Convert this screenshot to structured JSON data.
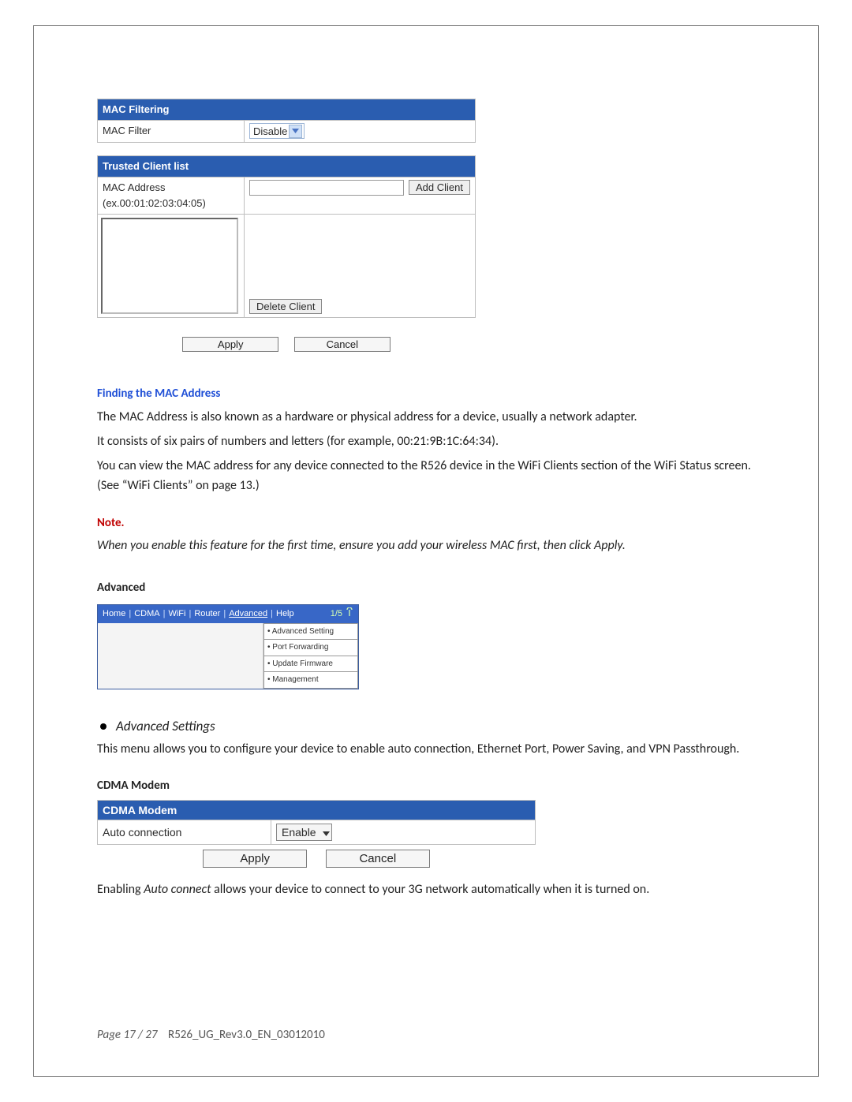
{
  "mac_filtering": {
    "header": "MAC Filtering",
    "row_label": "MAC Filter",
    "dropdown_value": "Disable"
  },
  "trusted": {
    "header": "Trusted Client list",
    "row_label": "MAC Address\n(ex.00:01:02:03:04:05)",
    "add_btn": "Add Client",
    "delete_btn": "Delete Client"
  },
  "macpanel_buttons": {
    "apply": "Apply",
    "cancel": "Cancel"
  },
  "finding_mac": {
    "heading": "Finding the MAC Address",
    "p1": "The MAC Address is also known as a hardware or physical address for a device, usually a network adapter.",
    "p2": "It consists of six pairs of numbers and letters (for example, 00:21:9B:1C:64:34).",
    "p3": "You can view the MAC address for any device connected to the R526 device in the WiFi Clients section of the WiFi Status screen. (See “WiFi Clients” on page 13.)"
  },
  "note": {
    "heading": "Note.",
    "text": "When you enable this feature for the first time, ensure you add your wireless MAC first, then click Apply."
  },
  "advanced": {
    "heading": "Advanced",
    "nav": {
      "items": [
        "Home",
        "CDMA",
        "WiFi",
        "Router",
        "Advanced",
        "Help"
      ],
      "signal": "1/5",
      "menu": [
        "Advanced Setting",
        "Port Forwarding",
        "Update Firmware",
        "Management"
      ]
    },
    "bullet": "Advanced Settings",
    "desc": "This menu allows you to configure your device to enable auto connection, Ethernet Port, Power Saving, and VPN Passthrough."
  },
  "cdma": {
    "sub": "CDMA Modem",
    "header": "CDMA Modem",
    "row_label": "Auto connection",
    "dropdown_value": "Enable",
    "apply": "Apply",
    "cancel": "Cancel",
    "after_pre": "Enabling ",
    "after_em": "Auto connect",
    "after_post": " allows your device to connect to your 3G network automatically when it is turned on."
  },
  "footer": {
    "page": "Page 17 / 27",
    "doc": "R526_UG_Rev3.0_EN_03012010"
  }
}
